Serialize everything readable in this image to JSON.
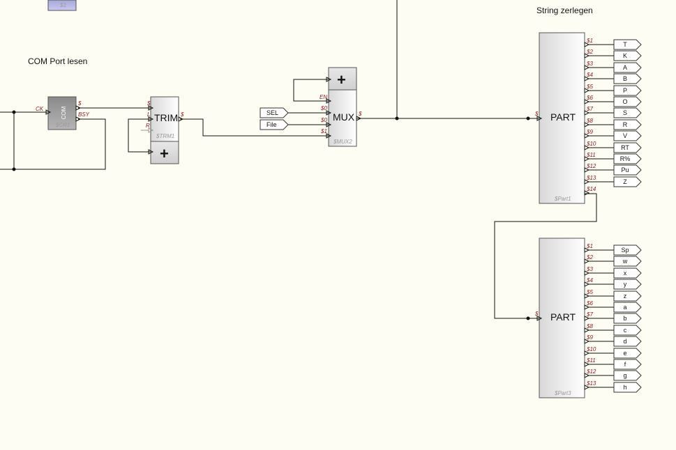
{
  "annotations": {
    "com_section": "COM Port lesen",
    "split_section": "String zerlegen"
  },
  "blocks": {
    "s1_ref": "$1",
    "com": {
      "title": "COM",
      "instance": "$CR1",
      "pins": {
        "ck": "CK",
        "s": "$",
        "bsy": "BSY"
      }
    },
    "trim": {
      "title": "TRIM",
      "instance": "$TRM1",
      "pins": {
        "in": "$",
        "out": "$",
        "l": "L",
        "r": "R"
      },
      "plus": "+"
    },
    "mux": {
      "title": "MUX",
      "instance": "$MUX2",
      "pins": {
        "en": "EN",
        "s0": "$0",
        "s0b": "$0",
        "s1": "$1",
        "out": "$"
      },
      "plus": "+"
    },
    "inputs": [
      "SEL",
      "File"
    ],
    "part1": {
      "title": "PART",
      "instance": "$Part1",
      "in": "$",
      "pins": [
        "$1",
        "$2",
        "$3",
        "$4",
        "$5",
        "$6",
        "$7",
        "$8",
        "$9",
        "$10",
        "$11",
        "$12",
        "$13",
        "$14"
      ],
      "outputs": [
        "T",
        "K",
        "A",
        "B",
        "P",
        "O",
        "S",
        "R",
        "V",
        "RT",
        "R%",
        "Pu",
        "Z"
      ]
    },
    "part3": {
      "title": "PART",
      "instance": "$Part3",
      "in": "$",
      "pins": [
        "$1",
        "$2",
        "$3",
        "$4",
        "$5",
        "$6",
        "$7",
        "$8",
        "$9",
        "$10",
        "$11",
        "$12",
        "$13"
      ],
      "outputs": [
        "Sp",
        "w",
        "x",
        "y",
        "z",
        "a",
        "b",
        "c",
        "d",
        "e",
        "f",
        "g",
        "h"
      ]
    }
  }
}
